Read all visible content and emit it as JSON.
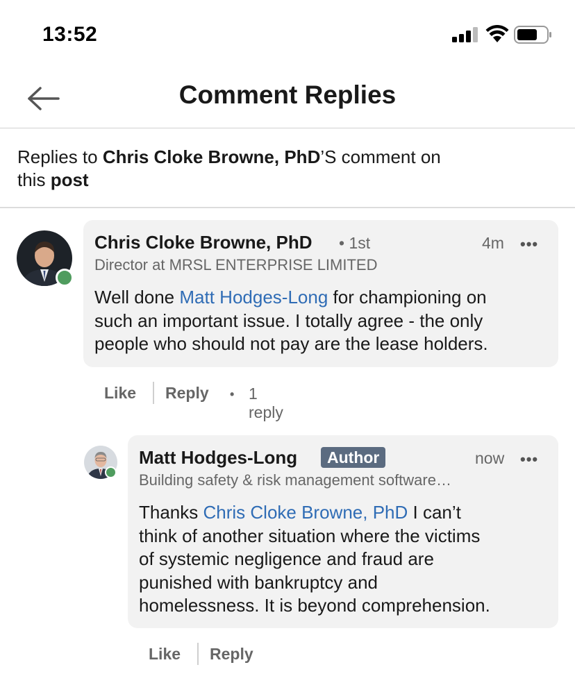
{
  "status_bar": {
    "time": "13:52"
  },
  "nav": {
    "title": "Comment Replies"
  },
  "context": {
    "prefix": "Replies to ",
    "name": "Chris Cloke Browne, PhD",
    "suffix": "’S comment on",
    "line2_prefix": "this ",
    "post_link": "post"
  },
  "comment": {
    "author": "Chris Cloke Browne, PhD",
    "degree": "• 1st",
    "headline": "Director at MRSL ENTERPRISE LIMITED",
    "timestamp": "4m",
    "more": "•••",
    "text_before": "Well done ",
    "mention": "Matt Hodges-Long",
    "line1_after": " for championing on",
    "line2": "such an important issue. I totally agree - the only",
    "line3": "people who should not pay are the lease holders.",
    "like_label": "Like",
    "reply_label": "Reply",
    "bullet": "•",
    "reply_count": "1 reply"
  },
  "reply": {
    "author": "Matt Hodges-Long",
    "badge": "Author",
    "headline": "Building safety & risk management software…",
    "timestamp": "now",
    "more": "•••",
    "text_before": "Thanks ",
    "mention": "Chris Cloke Browne, PhD",
    "line1_after": " I can’t",
    "line2": "think of another situation where the victims",
    "line3": "of systemic negligence and fraud are",
    "line4": "punished with bankruptcy and",
    "line5": "homelessness. It is beyond comprehension.",
    "like_label": "Like",
    "reply_label": "Reply"
  },
  "colors": {
    "mention": "#2f6cb5",
    "online": "#4f9c5e",
    "badge_bg": "#5b6b80",
    "bubble_bg": "#f2f2f2"
  }
}
